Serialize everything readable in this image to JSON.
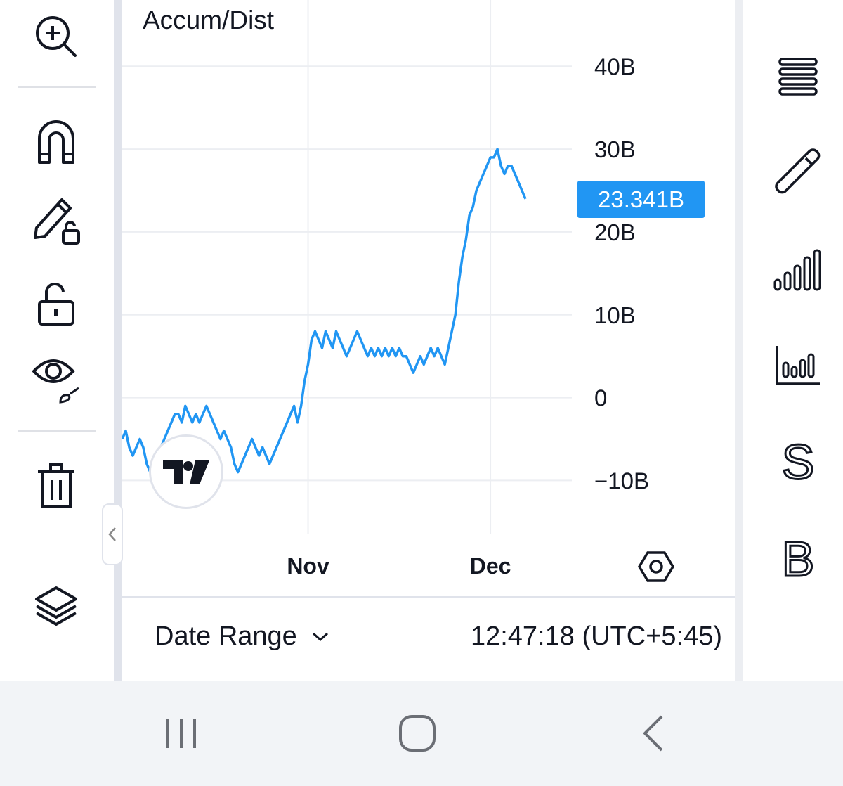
{
  "chart": {
    "indicator_title": "Accum/Dist",
    "price_tag": "23.341B",
    "settings_icon": "settings-hex-icon"
  },
  "chart_data": {
    "type": "line",
    "title": "Accum/Dist",
    "xlabel": "",
    "ylabel": "",
    "y_ticks": [
      "40B",
      "30B",
      "20B",
      "10B",
      "0",
      "−10B"
    ],
    "y_tick_values": [
      40,
      30,
      20,
      10,
      0,
      -10
    ],
    "x_ticks": [
      "Nov",
      "Dec"
    ],
    "ylim": [
      -16.5,
      48
    ],
    "y_units": "billions",
    "last_value": 23.341,
    "series_color": "#2196f3",
    "grid": true,
    "series": [
      {
        "values": [
          -5,
          -4,
          -6,
          -7,
          -6,
          -5,
          -6,
          -8,
          -9,
          -8,
          -7,
          -6,
          -5,
          -4,
          -3,
          -2,
          -2,
          -3,
          -1,
          -2,
          -3,
          -2,
          -3,
          -2,
          -1,
          -2,
          -3,
          -4,
          -5,
          -4,
          -5,
          -6,
          -8,
          -9,
          -8,
          -7,
          -6,
          -5,
          -6,
          -7,
          -6,
          -7,
          -8,
          -7,
          -6,
          -5,
          -4,
          -3,
          -2,
          -1,
          -3,
          -1,
          2,
          4,
          7,
          8,
          7,
          6,
          8,
          7,
          6,
          8,
          7,
          6,
          5,
          6,
          7,
          8,
          7,
          6,
          5,
          6,
          5,
          6,
          5,
          6,
          5,
          6,
          5,
          6,
          5,
          5,
          4,
          3,
          4,
          5,
          4,
          5,
          6,
          5,
          6,
          5,
          4,
          6,
          8,
          10,
          14,
          17,
          19,
          22,
          23,
          25,
          26,
          27,
          28,
          29,
          29,
          30,
          28,
          27,
          28,
          28,
          27,
          26,
          25,
          24
        ]
      }
    ]
  },
  "left_toolbar": {
    "icons": [
      "zoom-in-icon",
      "magnet-icon",
      "pencil-lock-icon",
      "unlock-icon",
      "eye-brush-icon",
      "trash-icon",
      "layers-icon"
    ]
  },
  "right_toolbar": {
    "icons": [
      "menu-lines-icon",
      "ruler-pen-icon",
      "signal-bars-icon",
      "bar-chart-icon"
    ],
    "s_label": "S",
    "b_label": "B"
  },
  "bottom_bar": {
    "date_range_label": "Date Range",
    "clock": "12:47:18 (UTC+5:45)"
  },
  "navbar": {
    "icons": [
      "recent-apps-icon",
      "home-icon",
      "back-icon"
    ]
  }
}
